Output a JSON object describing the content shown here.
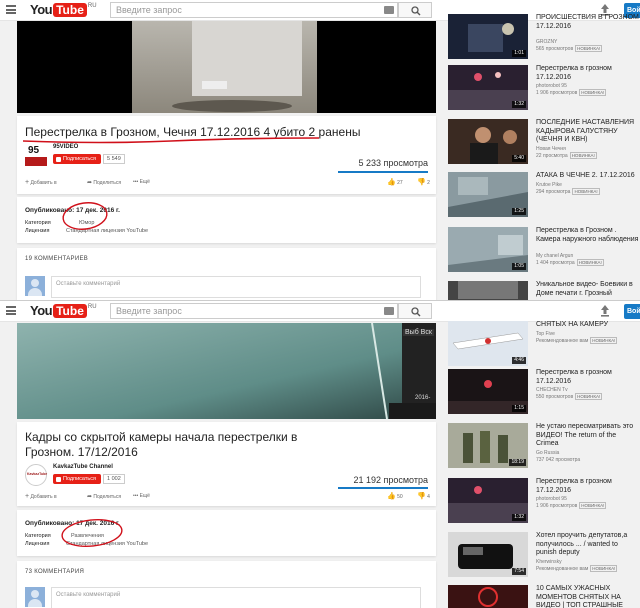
{
  "header": {
    "logo_you": "You",
    "logo_tube": "Tube",
    "logo_region": "RU",
    "search_placeholder": "Введите запрос",
    "signin_label": "Войт"
  },
  "colors": {
    "accent_red": "#e62117",
    "link_blue": "#167ac6",
    "annotation_red": "#d0101a"
  },
  "screens": [
    {
      "video_title": "Перестрелка в Грозном, Чечня 17.12.2016 4 убито 2 ранены",
      "channel_name": "95VIDEO",
      "channel_logo_text": "95",
      "subscribe_label": "Подписаться",
      "subscriber_count": "5 549",
      "views": "5 233 просмотра",
      "add_label": "Добавить в",
      "share_label": "Поделиться",
      "more_label": "Ещё",
      "likes": "27",
      "dislikes": "2",
      "published": "Опубликовано: 17 дек. 2016 г.",
      "category_label": "Категория",
      "category_value": "Юмор",
      "license_label": "Лицензия",
      "license_value": "Стандартная лицензия YouTube",
      "comments_header": "19 КОММЕНТАРИЕВ",
      "comment_placeholder": "Оставьте комментарий",
      "sidebar": [
        {
          "title": "ПРОИСШЕСТВИЯ В ГРОЗНОМ 17.12.2016",
          "channel": "GROZNY",
          "meta": "565 просмотров",
          "badge": "НОВИНКА!",
          "duration": "1:01"
        },
        {
          "title": "Перестрелка в грозном 17.12.2016",
          "channel": "photorobot 95",
          "meta": "1 906 просмотров",
          "badge": "НОВИНКА!",
          "duration": "1:32"
        },
        {
          "title": "ПОСЛЕДНИЕ НАСТАВЛЕНИЯ КАДЫРОВА ГАЛУСТЯНУ (ЧЕЧНЯ И КВН)",
          "channel": "Новая Чечня",
          "meta": "22 просмотра",
          "badge": "НОВИНКА!",
          "duration": "5:40"
        },
        {
          "title": "АТАКА В ЧЕЧНЕ 2. 17.12.2016",
          "channel": "Krutoe Pike",
          "meta": "294 просмотра",
          "badge": "НОВИНКА!",
          "duration": "1:25"
        },
        {
          "title": "Перестрелка в Грозном . Камера наружного наблюдения",
          "channel": "My chanel Argun",
          "meta": "1 404 просмотра",
          "badge": "НОВИНКА!",
          "duration": "1:05"
        },
        {
          "title": "Уникальное видео- Боевики в Доме печати г. Грозный",
          "channel": "",
          "meta": "",
          "badge": "",
          "duration": ""
        }
      ]
    },
    {
      "video_title": "Кадры со скрытой камеры начала перестрелки в Грозном. 17/12/2016",
      "channel_name": "KavkazTube Channel",
      "channel_logo_text": "KavkazTube",
      "subscribe_label": "Подписаться",
      "subscriber_count": "1 002",
      "views": "21 192 просмотра",
      "add_label": "Добавить в",
      "share_label": "Поделиться",
      "more_label": "Ещё",
      "likes": "50",
      "dislikes": "4",
      "overlay_text": "Выб Вск",
      "overlay_date": "2016-",
      "published": "Опубликовано: 17 дек. 2016 г.",
      "category_label": "Категория",
      "category_value": "Развлечения",
      "license_label": "Лицензия",
      "license_value": "Стандартная лицензия YouTube",
      "comments_header": "73 КОММЕНТАРИЯ",
      "comment_placeholder": "Оставьте комментарий",
      "sidebar": [
        {
          "title": "СНЯТЫХ НА КАМЕРУ",
          "channel": "Top Five",
          "meta": "Рекомендованное вам",
          "badge": "НОВИНКА!",
          "duration": "4:46"
        },
        {
          "title": "Перестрелка в грозном 17.12.2016",
          "channel": "CHECHEN Tv",
          "meta": "550 просмотров",
          "badge": "НОВИНКА!",
          "duration": "1:15"
        },
        {
          "title": "Не устаю пересматривать это ВИДЕО! The return of the Crimea",
          "channel": "Go Russia",
          "meta": "737 042 просмотра",
          "badge": "",
          "duration": "18:19"
        },
        {
          "title": "Перестрелка в грозном 17.12.2016",
          "channel": "photorobot 95",
          "meta": "1 906 просмотров",
          "badge": "НОВИНКА!",
          "duration": "1:32"
        },
        {
          "title": "Хотел проучить депутатов,а получилось ... / wanted to punish deputy",
          "channel": "Kherwinsky",
          "meta": "Рекомендованное вам",
          "badge": "НОВИНКА!",
          "duration": "7:54"
        },
        {
          "title": "10 САМЫХ УЖАСНЫХ МОМЕНТОВ СНЯТЫХ НА ВИДЕО | ТОП СТРАШНЫЕ",
          "channel": "",
          "meta": "",
          "badge": "",
          "duration": ""
        }
      ]
    }
  ]
}
